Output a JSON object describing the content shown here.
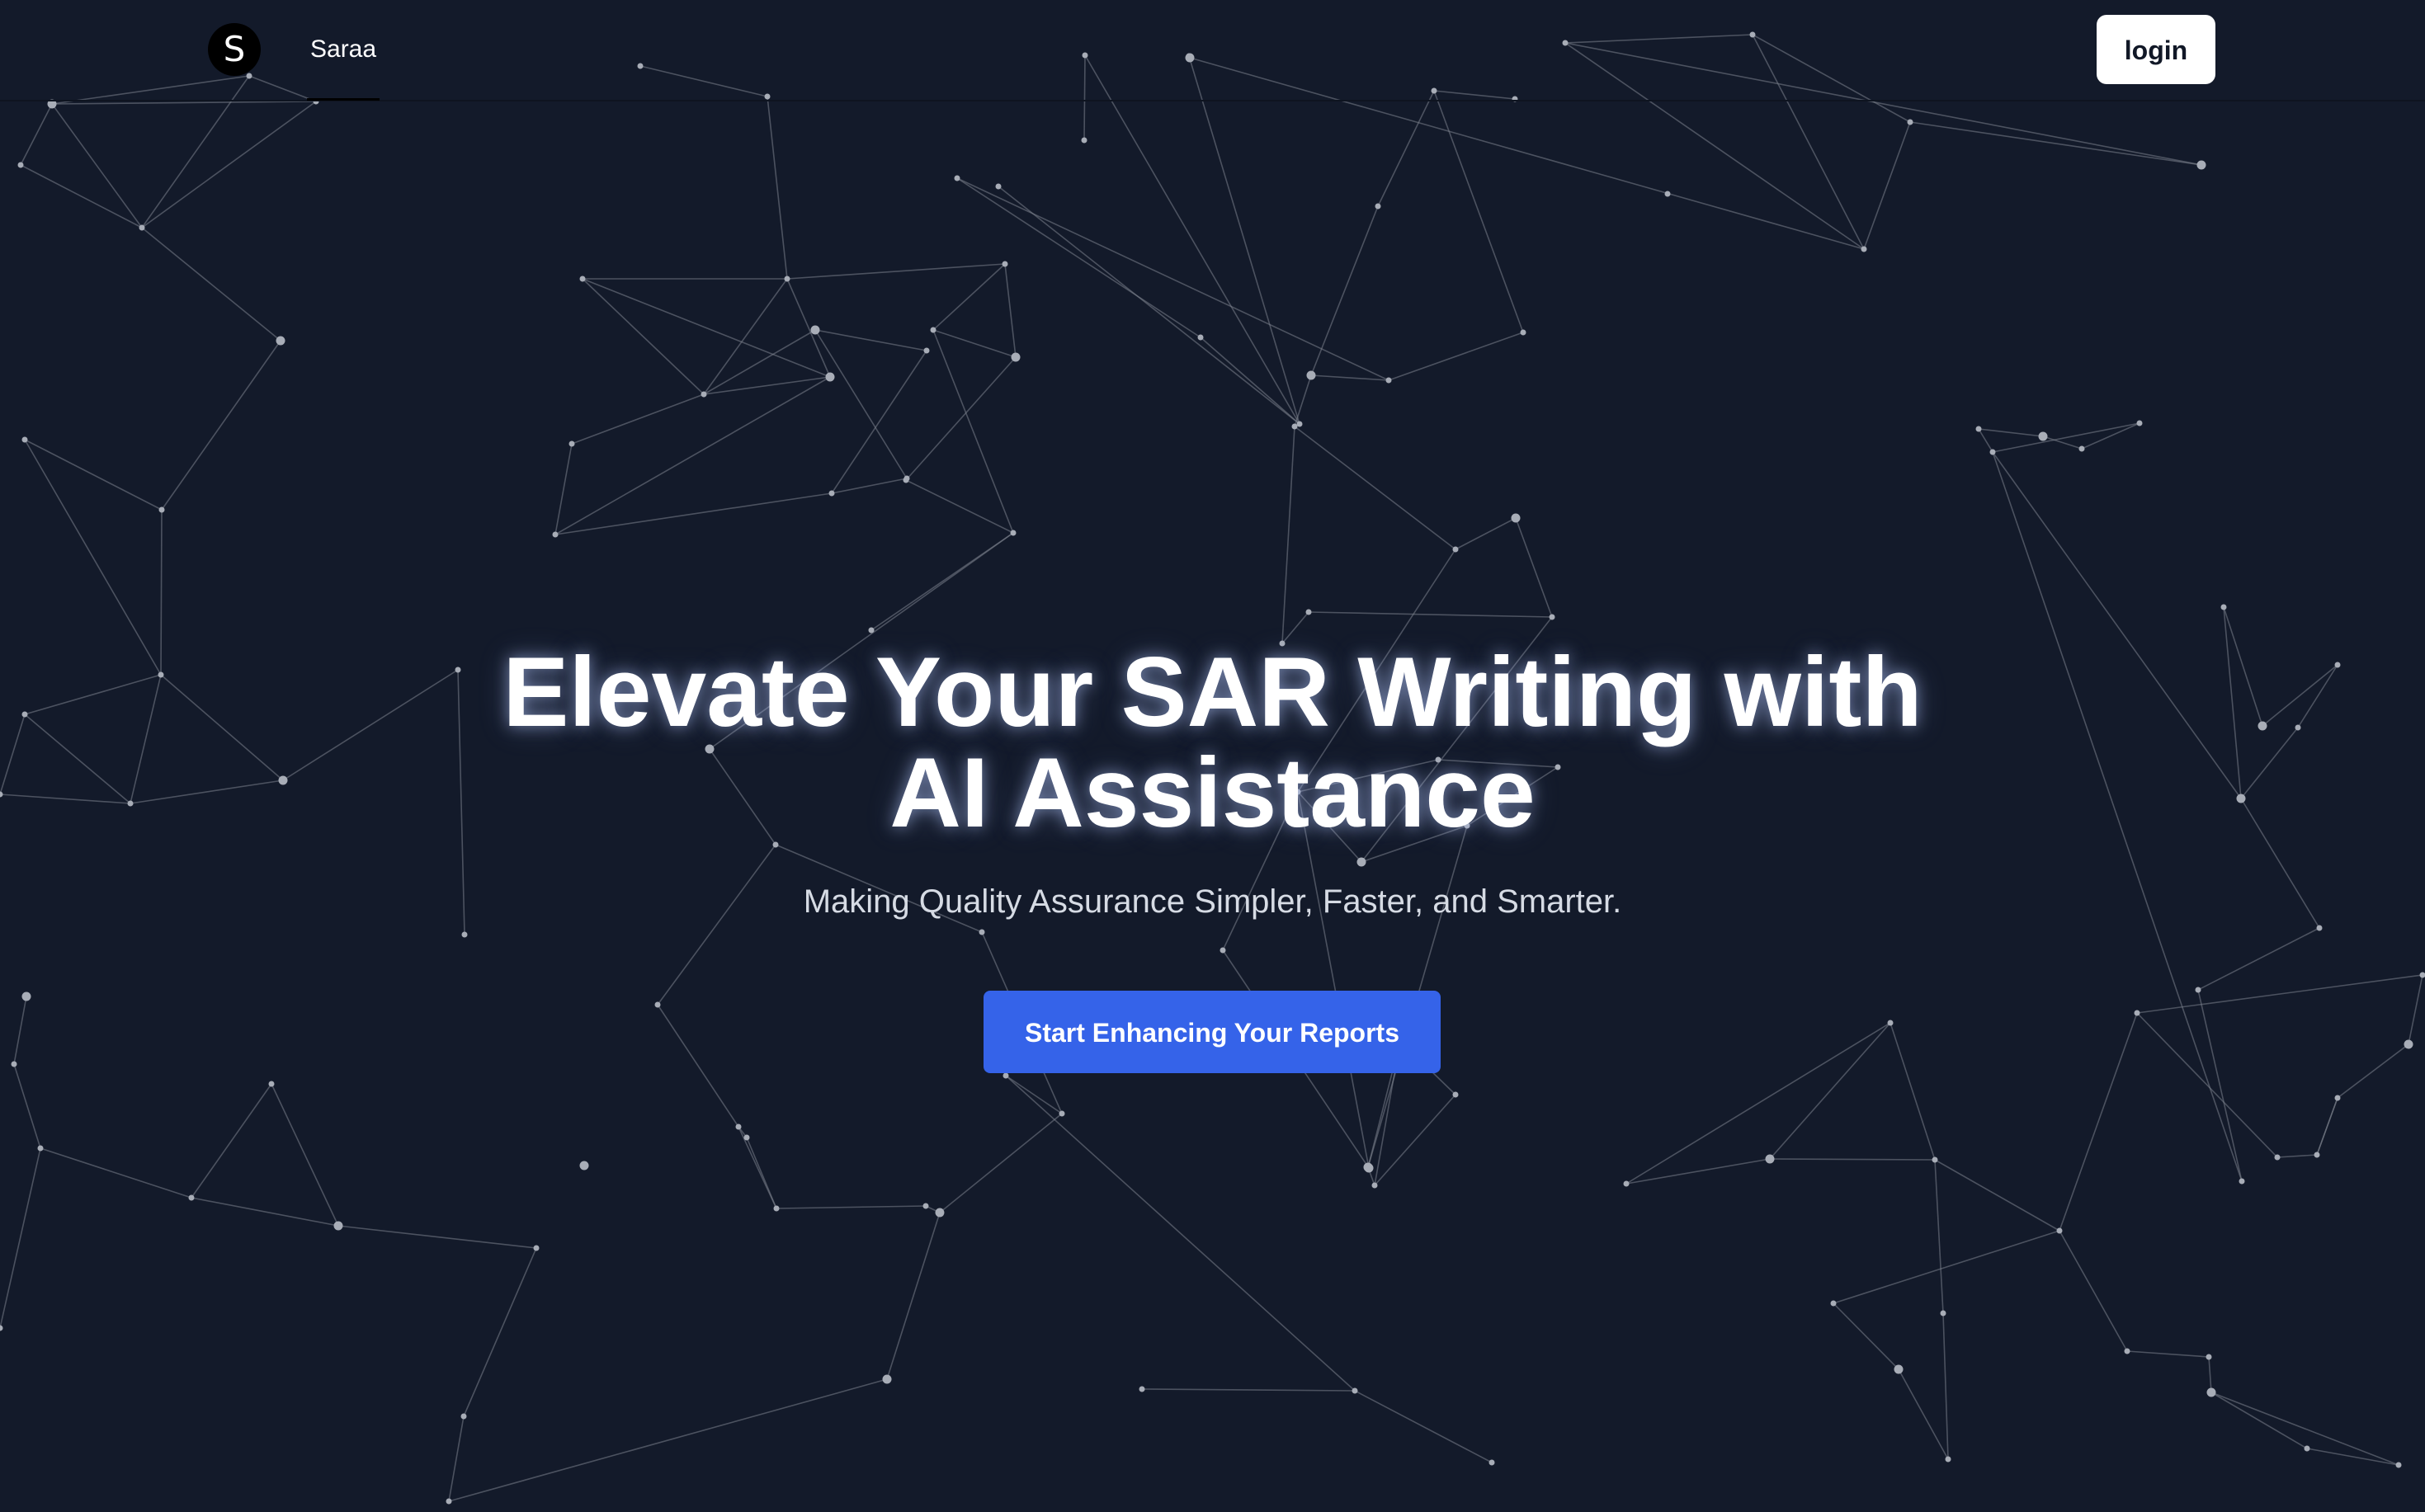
{
  "header": {
    "logo_letter": "S",
    "brand_name": "Saraa",
    "login_label": "login"
  },
  "hero": {
    "title_line1": "Elevate Your SAR Writing with",
    "title_line2": "AI Assistance",
    "subtitle": "Making Quality Assurance Simpler, Faster, and Smarter.",
    "cta_label": "Start Enhancing Your Reports"
  },
  "colors": {
    "background": "#131a2a",
    "accent": "#3563e9",
    "text": "#ffffff",
    "network_lines": "#6b7280"
  },
  "background_decoration": "network-nodes-and-lines"
}
